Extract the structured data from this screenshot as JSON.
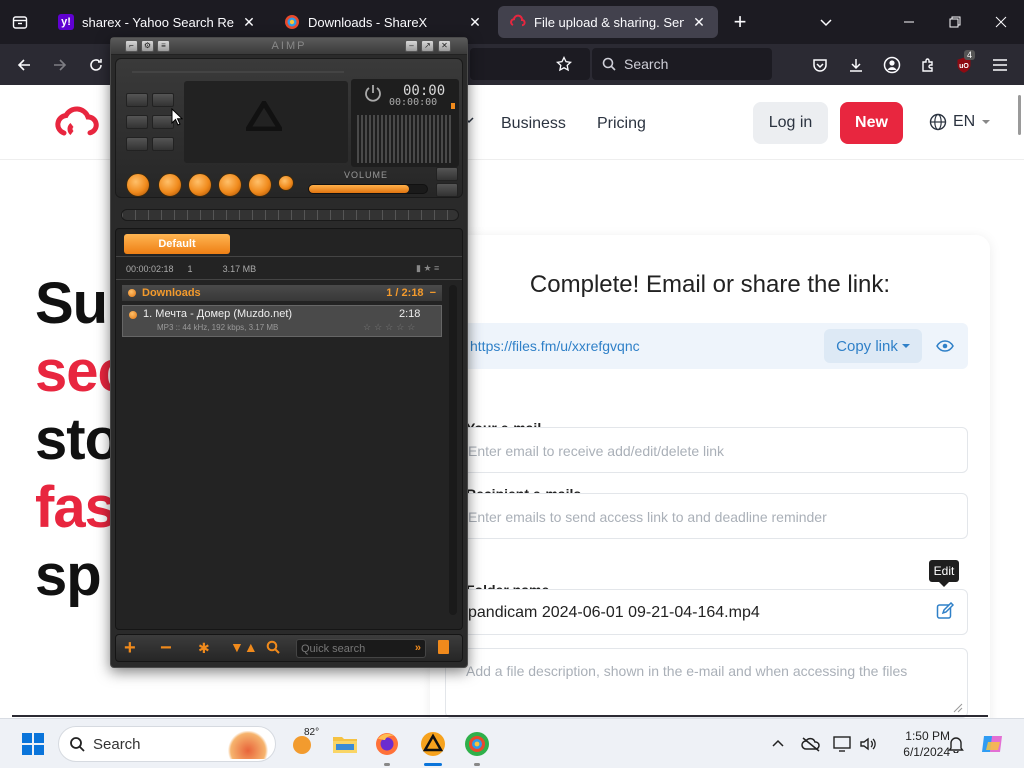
{
  "browser": {
    "tabs": [
      {
        "title": "sharex - Yahoo Search Results",
        "favicon": "yahoo",
        "active": false
      },
      {
        "title": "Downloads - ShareX",
        "favicon": "sharex",
        "active": false
      },
      {
        "title": "File upload & sharing. Send large",
        "favicon": "filesfm",
        "active": true
      }
    ],
    "search_placeholder": "Search",
    "notification_badge": "4"
  },
  "site": {
    "nav": {
      "business": "Business",
      "pricing": "Pricing",
      "login": "Log in",
      "new": "New",
      "lang": "EN"
    },
    "hero": {
      "line1": "Su",
      "line2": "sec",
      "line3": "sto",
      "line4": "fas",
      "line5": "sp"
    },
    "card": {
      "title": "Complete! Email or share the link:",
      "link": "https://files.fm/u/xxrefgvqnc",
      "copy_label": "Copy link",
      "email_label": "Your e-mail",
      "email_placeholder": "Enter email to receive add/edit/delete link",
      "recipients_label": "Recipient e-mails",
      "recipients_placeholder": "Enter emails to send access link to and deadline reminder",
      "folder_label": "Folder name",
      "folder_value": "pandicam 2024-06-01 09-21-04-164.mp4",
      "edit_tooltip": "Edit",
      "description_placeholder": "Add a file description, shown in the e-mail and when accessing the files"
    }
  },
  "aimp": {
    "title": "AIMP",
    "time": "00:00",
    "time_sub": "00:00:00",
    "volume_label": "VOLUME",
    "volume_level": 0.85,
    "playlist_tab": "Default",
    "playlist_info": {
      "duration": "00:00:02:18",
      "count": "1",
      "size": "3.17 MB"
    },
    "group": {
      "name": "Downloads",
      "summary": "1 / 2:18"
    },
    "track": {
      "title": "1. Мечта - Домер (Muzdo.net)",
      "duration": "2:18",
      "details": "MP3 :: 44 kHz, 192 kbps, 3.17 MB"
    },
    "quick_search_placeholder": "Quick search"
  },
  "taskbar": {
    "search_label": "Search",
    "weather_temp": "82°",
    "time": "1:50 PM",
    "date": "6/1/2024"
  },
  "colors": {
    "brand_red": "#e8263f",
    "link_blue": "#2f80c8",
    "aimp_orange": "#f08a1c"
  }
}
